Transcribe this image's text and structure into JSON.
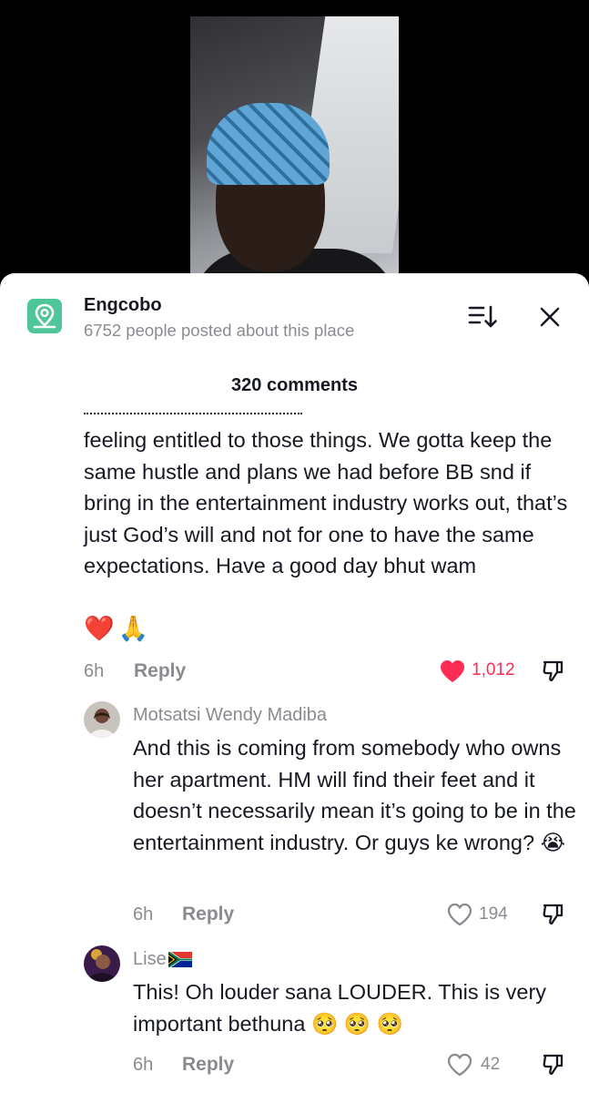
{
  "place": {
    "title": "Engcobo",
    "subtitle": "6752 people posted about this place"
  },
  "comment_count": "320 comments",
  "comments": [
    {
      "text": "feeling entitled to those things. We gotta keep the same hustle and plans we had before BB snd if bring in the entertainment industry works out, that’s just God’s will and not for one to have the same expectations. Have a good day bhut wam",
      "emojis": [
        "❤️",
        "🙏"
      ],
      "time": "6h",
      "reply_label": "Reply",
      "likes": "1,012",
      "liked": true
    },
    {
      "username": "Motsatsi Wendy Madiba",
      "text": "And this is coming from somebody who owns her apartment. HM will find their feet and it doesn’t necessarily mean it’s going to be in the entertainment industry. Or guys ke wrong? 😭",
      "time": "6h",
      "reply_label": "Reply",
      "likes": "194",
      "liked": false
    },
    {
      "username": "Lise",
      "text": "This! Oh louder sana LOUDER. This is very important bethuna 🥺 🥺 🥺",
      "time": "6h",
      "reply_label": "Reply",
      "likes": "42",
      "liked": false
    }
  ],
  "colors": {
    "like_active": "#fe2c55",
    "muted": "#8a8b91",
    "place_badge": "#4fc59a"
  }
}
